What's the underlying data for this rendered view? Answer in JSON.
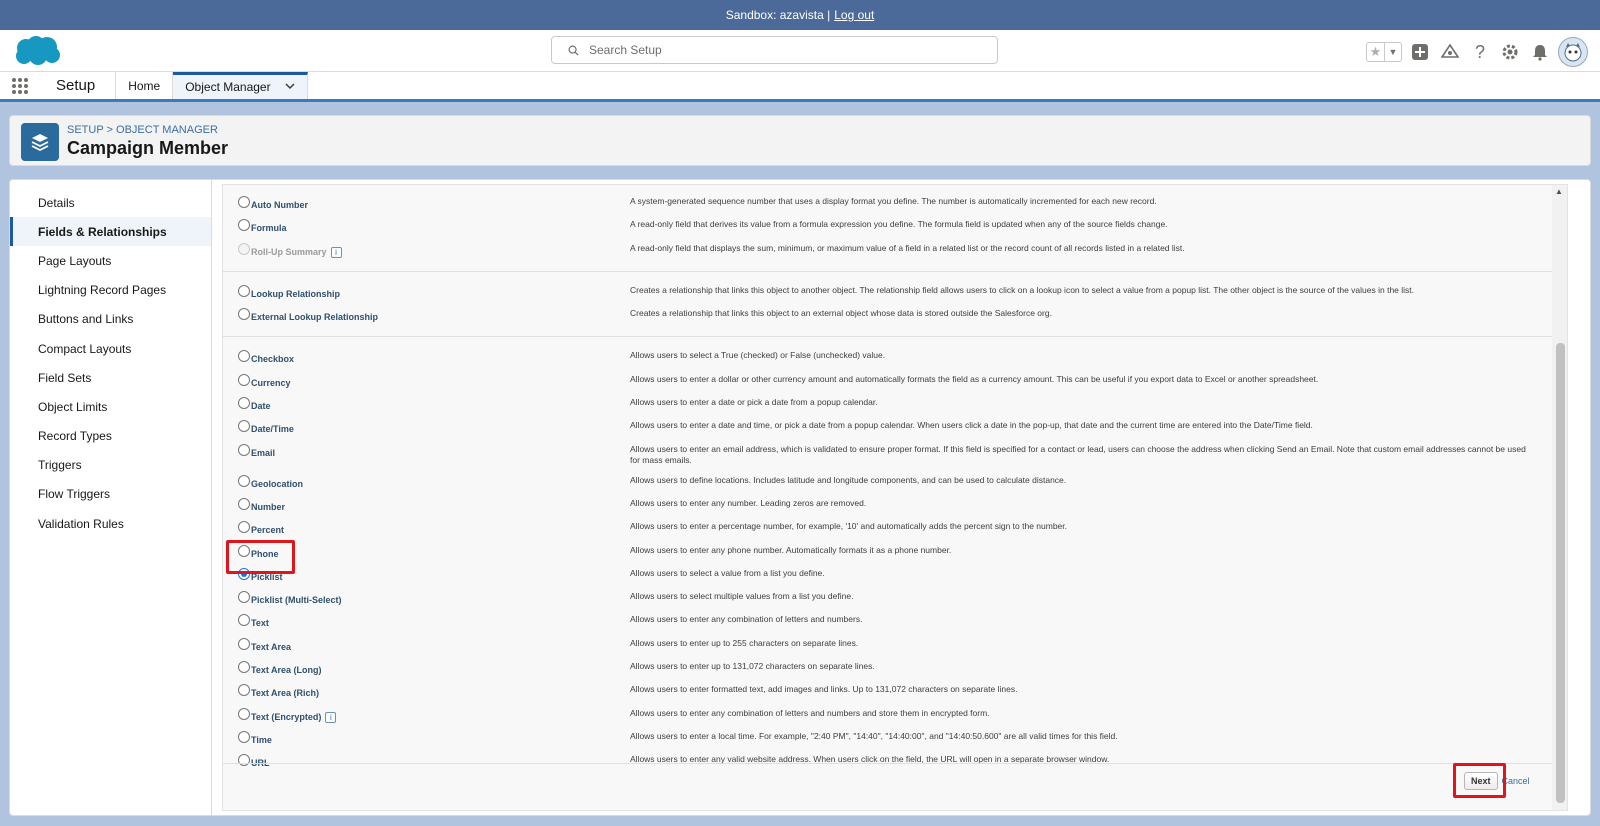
{
  "sandbox_bar": {
    "text": "Sandbox: azavista |",
    "logout": "Log out"
  },
  "header": {
    "search_placeholder": "Search Setup",
    "icons": [
      "favorites-icon",
      "add-icon",
      "trailhead-icon",
      "help-icon",
      "setup-gear-icon",
      "notifications-bell-icon",
      "user-avatar"
    ]
  },
  "context_nav": {
    "app_name": "Setup",
    "tabs": [
      {
        "label": "Home"
      },
      {
        "label": "Object Manager"
      }
    ]
  },
  "object_header": {
    "breadcrumb_setup": "SETUP",
    "breadcrumb_sep": " > ",
    "breadcrumb_object_manager": "OBJECT MANAGER",
    "title": "Campaign Member"
  },
  "sidebar": {
    "items": [
      {
        "label": "Details"
      },
      {
        "label": "Fields & Relationships"
      },
      {
        "label": "Page Layouts"
      },
      {
        "label": "Lightning Record Pages"
      },
      {
        "label": "Buttons and Links"
      },
      {
        "label": "Compact Layouts"
      },
      {
        "label": "Field Sets"
      },
      {
        "label": "Object Limits"
      },
      {
        "label": "Record Types"
      },
      {
        "label": "Triggers"
      },
      {
        "label": "Flow Triggers"
      },
      {
        "label": "Validation Rules"
      }
    ],
    "active": "Fields & Relationships"
  },
  "field_types": {
    "section1": [
      {
        "label": "Auto Number",
        "desc": "A system-generated sequence number that uses a display format you define. The number is automatically incremented for each new record."
      },
      {
        "label": "Formula",
        "desc": "A read-only field that derives its value from a formula expression you define. The formula field is updated when any of the source fields change."
      },
      {
        "label": "Roll-Up Summary",
        "desc": "A read-only field that displays the sum, minimum, or maximum value of a field in a related list or the record count of all records listed in a related list."
      }
    ],
    "section2": [
      {
        "label": "Lookup Relationship",
        "desc": "Creates a relationship that links this object to another object. The relationship field allows users to click on a lookup icon to select a value from a popup list. The other object is the source of the values in the list."
      },
      {
        "label": "External Lookup Relationship",
        "desc": "Creates a relationship that links this object to an external object whose data is stored outside the Salesforce org."
      }
    ],
    "section3": [
      {
        "label": "Checkbox",
        "desc": "Allows users to select a True (checked) or False (unchecked) value."
      },
      {
        "label": "Currency",
        "desc": "Allows users to enter a dollar or other currency amount and automatically formats the field as a currency amount. This can be useful if you export data to Excel or another spreadsheet."
      },
      {
        "label": "Date",
        "desc": "Allows users to enter a date or pick a date from a popup calendar."
      },
      {
        "label": "Date/Time",
        "desc": "Allows users to enter a date and time, or pick a date from a popup calendar. When users click a date in the pop-up, that date and the current time are entered into the Date/Time field."
      },
      {
        "label": "Email",
        "desc": "Allows users to enter an email address, which is validated to ensure proper format. If this field is specified for a contact or lead, users can choose the address when clicking Send an Email. Note that custom email addresses cannot be used for mass emails."
      },
      {
        "label": "Geolocation",
        "desc": "Allows users to define locations. Includes latitude and longitude components, and can be used to calculate distance."
      },
      {
        "label": "Number",
        "desc": "Allows users to enter any number. Leading zeros are removed."
      },
      {
        "label": "Percent",
        "desc": "Allows users to enter a percentage number, for example, '10' and automatically adds the percent sign to the number."
      },
      {
        "label": "Phone",
        "desc": "Allows users to enter any phone number. Automatically formats it as a phone number."
      },
      {
        "label": "Picklist",
        "desc": "Allows users to select a value from a list you define."
      },
      {
        "label": "Picklist (Multi-Select)",
        "desc": "Allows users to select multiple values from a list you define."
      },
      {
        "label": "Text",
        "desc": "Allows users to enter any combination of letters and numbers."
      },
      {
        "label": "Text Area",
        "desc": "Allows users to enter up to 255 characters on separate lines."
      },
      {
        "label": "Text Area (Long)",
        "desc": "Allows users to enter up to 131,072 characters on separate lines."
      },
      {
        "label": "Text Area (Rich)",
        "desc": "Allows users to enter formatted text, add images and links. Up to 131,072 characters on separate lines."
      },
      {
        "label": "Text (Encrypted)",
        "desc": "Allows users to enter any combination of letters and numbers and store them in encrypted form."
      },
      {
        "label": "Time",
        "desc": "Allows users to enter a local time. For example, \"2:40 PM\", \"14:40\", \"14:40:00\", and \"14:40:50.600\" are all valid times for this field."
      },
      {
        "label": "URL",
        "desc": "Allows users to enter any valid website address. When users click on the field, the URL will open in a separate browser window."
      }
    ],
    "selected": "Picklist",
    "info_marker": "i"
  },
  "buttons": {
    "next": "Next",
    "cancel": "Cancel"
  },
  "colors": {
    "sandbox_bar": "#4b6a9a",
    "brand_blue": "#1b5aa0",
    "highlight": "#e0151b",
    "field_label": "#30506e"
  }
}
